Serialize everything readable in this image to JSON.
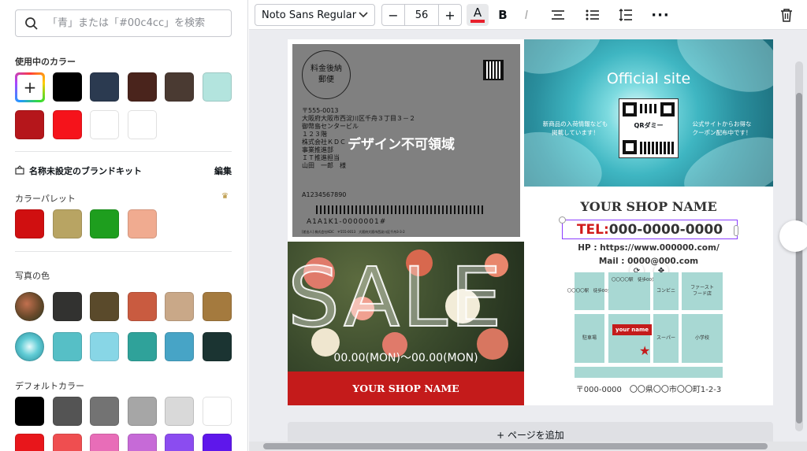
{
  "search": {
    "placeholder": "「青」または「#00c4cc」を検索"
  },
  "used_colors": {
    "title": "使用中のカラー",
    "swatches": [
      "#000000",
      "#2b3a50",
      "#4a241c",
      "#4a3a32",
      "#b3e4de",
      "#b5161b",
      "#f5131b",
      "#ffffff",
      "#ffffff"
    ]
  },
  "brand_kit": {
    "title": "名称未設定のブランドキット",
    "edit": "編集"
  },
  "palette": {
    "title": "カラーパレット",
    "swatches": [
      "#d00f10",
      "#b8a463",
      "#1e9e1e",
      "#f0ab90"
    ]
  },
  "photo_colors": {
    "title": "写真の色",
    "swatches": [
      "#323230",
      "#5a4a2b",
      "#c95b40",
      "#c9a888",
      "#a47a3e",
      "#56bfc6",
      "#88d6e6",
      "#2fa29a",
      "#47a4c6",
      "#1b3432"
    ]
  },
  "default_colors": {
    "title": "デフォルトカラー",
    "swatches": [
      "#000000",
      "#545454",
      "#737373",
      "#a6a6a6",
      "#d9d9d9",
      "#ffffff"
    ],
    "partial": [
      "#e8161b",
      "#ef4e50",
      "#e86db8",
      "#c66ad7",
      "#8b4cf0",
      "#5e17eb"
    ]
  },
  "toolbar": {
    "font": "Noto Sans Regular",
    "size": "56",
    "minus": "−",
    "plus": "+",
    "text_color": "#e81f2b"
  },
  "canvas": {
    "add_page": "+ ページを追加",
    "postmark": [
      "料金後納",
      "郵便"
    ],
    "address_lines": "〒555-0013\n大阪府大阪市西淀川区千舟３丁目３－２\n御幣島センタービル\n１２３階\n株式会社ＫＤＣ\n事業推進部\nＩＴ推進担当\n山田　一郎　様",
    "no_design": "デザイン不可領域",
    "barcode_number": "A1234567890",
    "barcode_label": "A1A1K1-0000001#",
    "small_line": "[差出人] 株式会社KDC　〒555-0013　大阪府大阪市西淀川区千舟3-3-2",
    "official": "Official site",
    "left_msg": "新商品の入荷情報なども\n掲載しています！",
    "right_msg": "公式サイトからお得な\nクーポン配布中です！",
    "qr_label": "QRダミー",
    "sale": "SALE",
    "sale_date": "00.00(MON)〜00.00(MON)",
    "shop_bar": "YOUR SHOP NAME",
    "shop_name": "YOUR SHOP NAME",
    "tel_prefix": "TEL:",
    "tel_number": "000-0000-0000",
    "hp": "HP : https://www.000000.com/",
    "mail": "Mail : 0000@000.com",
    "map_station1": "〇〇〇〇駅　徒歩00分",
    "map_station2": "〇〇〇〇駅　徒歩00分",
    "map_conbini": "コンビニ",
    "map_fastfood": "ファースト\nフード店",
    "map_parking": "駐車場",
    "map_yourname": "your name",
    "map_super": "スーパー",
    "map_school": "小学校",
    "address_bottom": "〒000-0000　〇〇県〇〇市〇〇町1-2-3"
  }
}
